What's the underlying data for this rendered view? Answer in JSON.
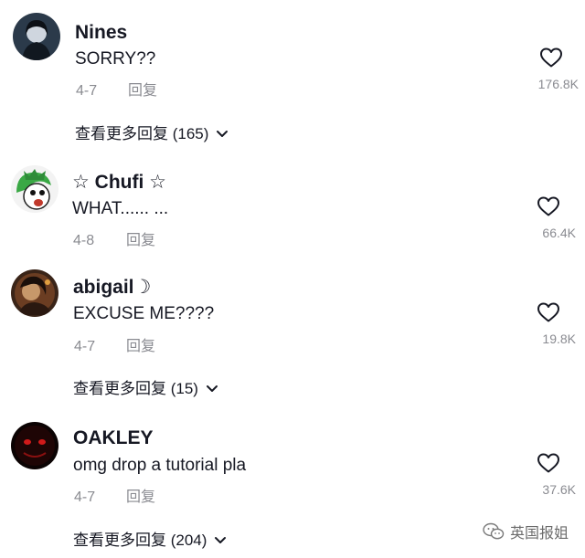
{
  "comments": [
    {
      "username": "Nines",
      "text": "SORRY??",
      "date": "4-7",
      "reply_label": "回复",
      "like_count": "176.8K",
      "more_replies": "查看更多回复 (165)"
    },
    {
      "username": "☆ Chufi ☆",
      "text": "WHAT...... ...",
      "date": "4-8",
      "reply_label": "回复",
      "like_count": "66.4K"
    },
    {
      "username": "abigail☽",
      "text": "EXCUSE ME????",
      "date": "4-7",
      "reply_label": "回复",
      "like_count": "19.8K",
      "more_replies": "查看更多回复 (15)"
    },
    {
      "username": "OAKLEY",
      "text": "omg drop a tutorial pla",
      "date": "4-7",
      "reply_label": "回复",
      "like_count": "37.6K",
      "more_replies": "查看更多回复 (204)"
    }
  ],
  "watermark": {
    "text": "英国报姐",
    "icon": "wechat-icon"
  },
  "colors": {
    "primary_text": "#161823",
    "secondary_text": "#8a8b91",
    "background": "#ffffff"
  },
  "icons": {
    "like": "heart-outline-icon",
    "expand": "chevron-down-icon"
  }
}
